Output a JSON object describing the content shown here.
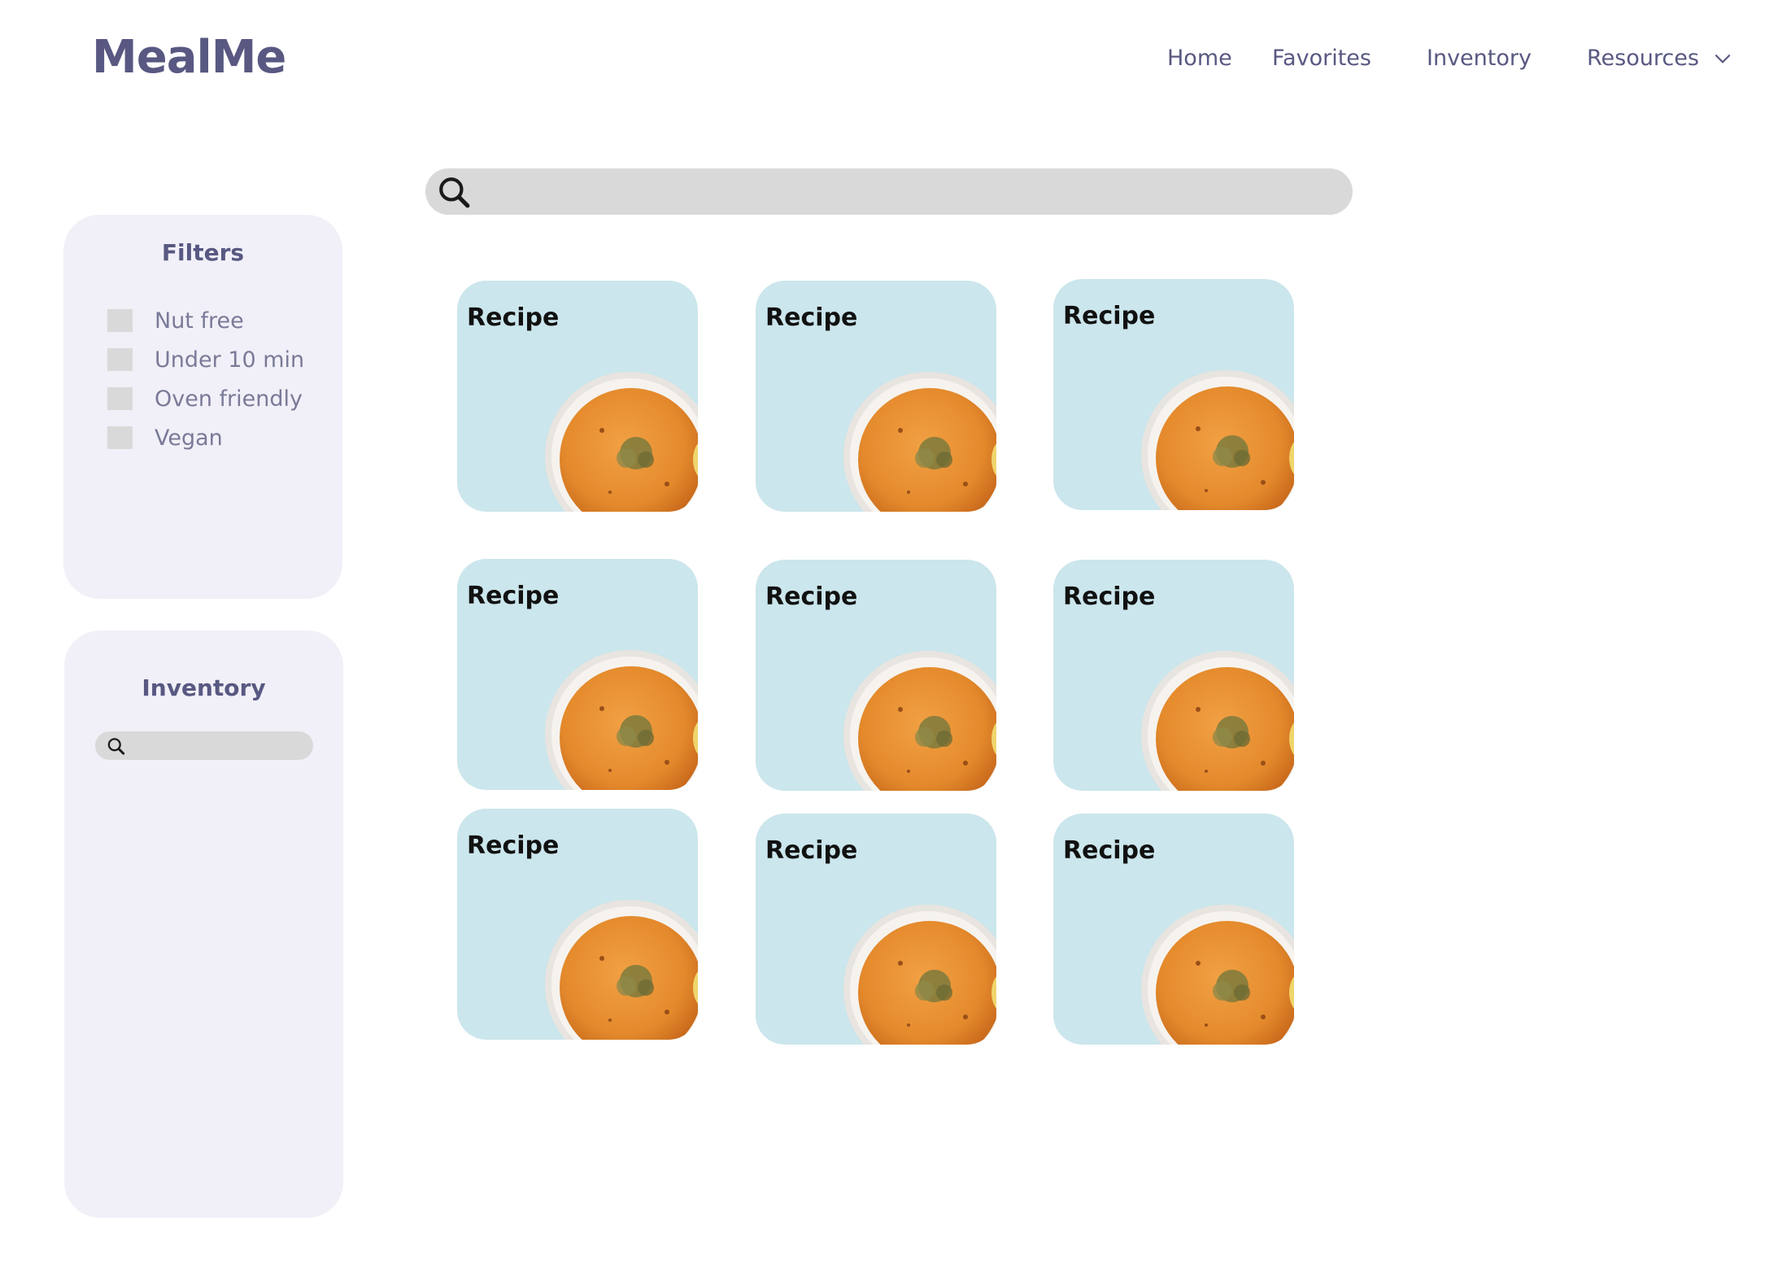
{
  "header": {
    "logo": "MealMe",
    "nav": {
      "home": "Home",
      "favorites": "Favorites",
      "inventory": "Inventory",
      "resources": "Resources"
    }
  },
  "search": {
    "placeholder": ""
  },
  "filters": {
    "title": "Filters",
    "items": [
      {
        "label": "Nut free"
      },
      {
        "label": "Under 10 min"
      },
      {
        "label": "Oven friendly"
      },
      {
        "label": "Vegan"
      }
    ]
  },
  "inventory_panel": {
    "title": "Inventory",
    "search_placeholder": ""
  },
  "recipes": [
    {
      "title": "Recipe"
    },
    {
      "title": "Recipe"
    },
    {
      "title": "Recipe"
    },
    {
      "title": "Recipe"
    },
    {
      "title": "Recipe"
    },
    {
      "title": "Recipe"
    },
    {
      "title": "Recipe"
    },
    {
      "title": "Recipe"
    },
    {
      "title": "Recipe"
    }
  ],
  "colors": {
    "brand": "#585882",
    "panel_bg": "#f1f0f8",
    "card_bg": "#cbe6ec",
    "search_bg": "#d9d9d9"
  }
}
